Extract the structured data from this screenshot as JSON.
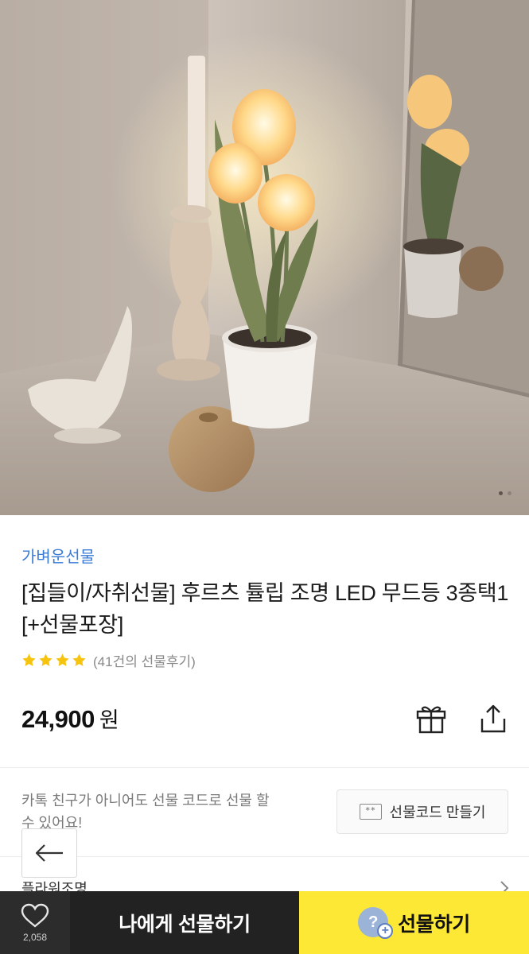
{
  "product": {
    "brand": "가벼운선물",
    "title": "[집들이/자취선물] 후르츠 튤립 조명 LED 무드등 3종택1 [+선물포장]",
    "rating": 4,
    "review_count": "(41건의 선물후기)",
    "price": "24,900",
    "currency": "원",
    "image_count": 2,
    "image_index": 1
  },
  "gift_code": {
    "description": "카톡 친구가 아니어도 선물 코드로 선물 할 수 있어요!",
    "button_label": "선물코드 만들기",
    "icon_text": "**"
  },
  "category": {
    "label": "플라워조명"
  },
  "bottom_bar": {
    "like_count": "2,058",
    "self_gift_label": "나에게 선물하기",
    "gift_label": "선물하기",
    "friend_icon_text": "?",
    "accent_color": "#fde836"
  },
  "icons": [
    "heart-icon",
    "gift-icon",
    "share-icon",
    "back-arrow-icon",
    "chevron-right-icon",
    "star-icon",
    "friend-add-icon"
  ]
}
